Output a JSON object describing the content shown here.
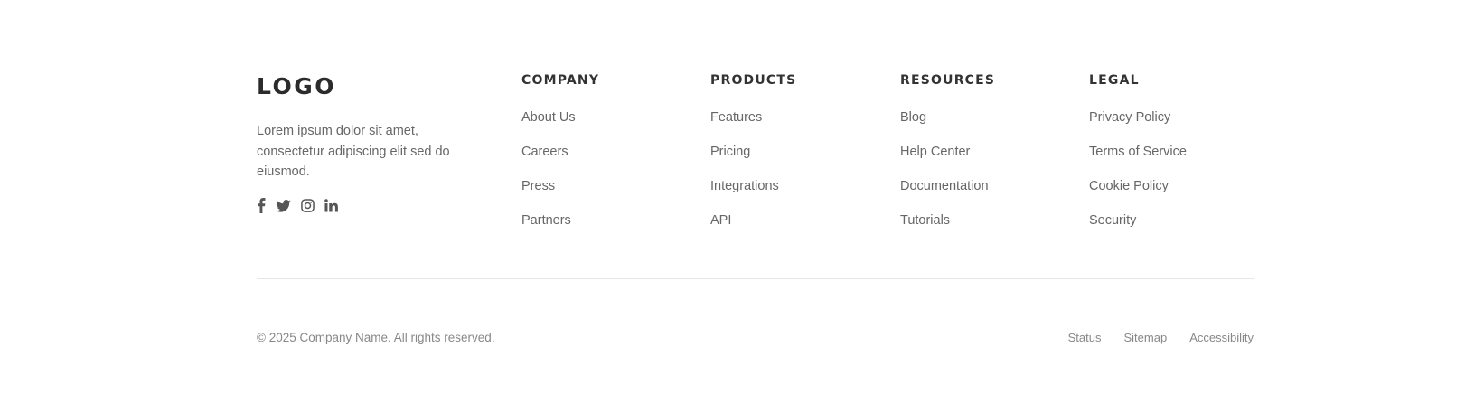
{
  "brand": {
    "logo": "LOGO",
    "tagline": "Lorem ipsum dolor sit amet, consectetur adipiscing elit sed do eiusmod.",
    "social": [
      "facebook-icon",
      "twitter-icon",
      "instagram-icon",
      "linkedin-icon"
    ]
  },
  "columns": [
    {
      "heading": "COMPANY",
      "links": [
        "About Us",
        "Careers",
        "Press",
        "Partners"
      ]
    },
    {
      "heading": "PRODUCTS",
      "links": [
        "Features",
        "Pricing",
        "Integrations",
        "API"
      ]
    },
    {
      "heading": "RESOURCES",
      "links": [
        "Blog",
        "Help Center",
        "Documentation",
        "Tutorials"
      ]
    },
    {
      "heading": "LEGAL",
      "links": [
        "Privacy Policy",
        "Terms of Service",
        "Cookie Policy",
        "Security"
      ]
    }
  ],
  "bottom": {
    "copyright": "© 2025 Company Name. All rights reserved.",
    "links": [
      "Status",
      "Sitemap",
      "Accessibility"
    ]
  },
  "colors": {
    "heading": "#333333",
    "link": "#666666",
    "muted": "#888888",
    "divider": "#e6e6e6"
  }
}
